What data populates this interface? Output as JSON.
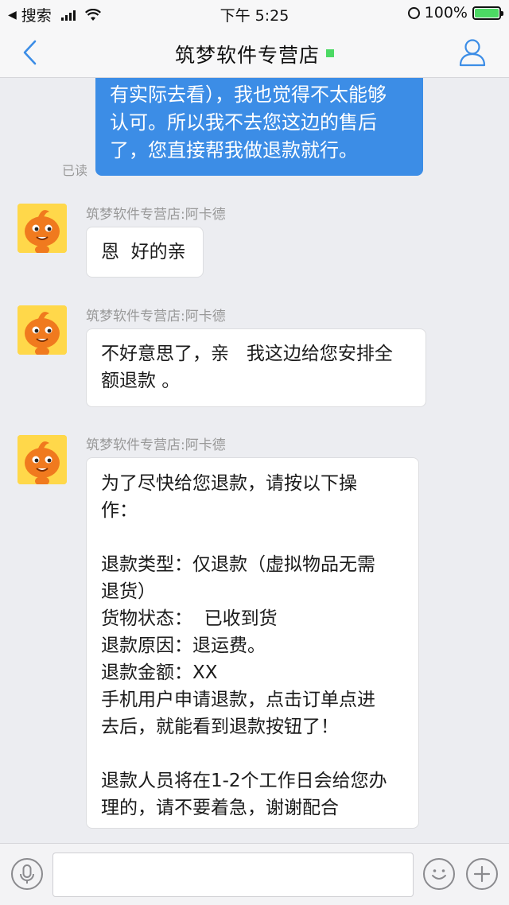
{
  "status_bar": {
    "back_app": "搜索",
    "time": "下午 5:25",
    "battery": "100%"
  },
  "header": {
    "title": "筑梦软件专营店",
    "online_color": "#4cd964"
  },
  "colors": {
    "accent": "#3c8de6",
    "background": "#ecedf1"
  },
  "messages": [
    {
      "from": "me",
      "lines": [
        "有实际去看），我也觉得不太能够",
        "认可。所以我不去您这边的售后",
        "了，您直接帮我做退款就行。"
      ],
      "status": "已读"
    },
    {
      "from": "shop",
      "sender": "筑梦软件专营店:阿卡德",
      "lines": [
        "恩  好的亲"
      ]
    },
    {
      "from": "shop",
      "sender": "筑梦软件专营店:阿卡德",
      "lines": [
        "不好意思了，亲   我这边给您安排全",
        "额退款 。"
      ]
    },
    {
      "from": "shop",
      "sender": "筑梦软件专营店:阿卡德",
      "lines": [
        "为了尽快给您退款，请按以下操",
        "作：",
        "",
        "退款类型：仅退款（虚拟物品无需",
        "退货）",
        "货物状态：  已收到货",
        "退款原因：退运费。",
        "退款金额：XX",
        "手机用户申请退款，点击订单点进",
        "去后，就能看到退款按钮了！",
        "",
        "退款人员将在1-2个工作日会给您办",
        "理的，请不要着急，谢谢配合"
      ]
    }
  ],
  "input_bar": {
    "value": "",
    "placeholder": "",
    "left_icon": "microphone-icon",
    "right_icons": [
      "emoji-icon",
      "plus-icon"
    ]
  }
}
